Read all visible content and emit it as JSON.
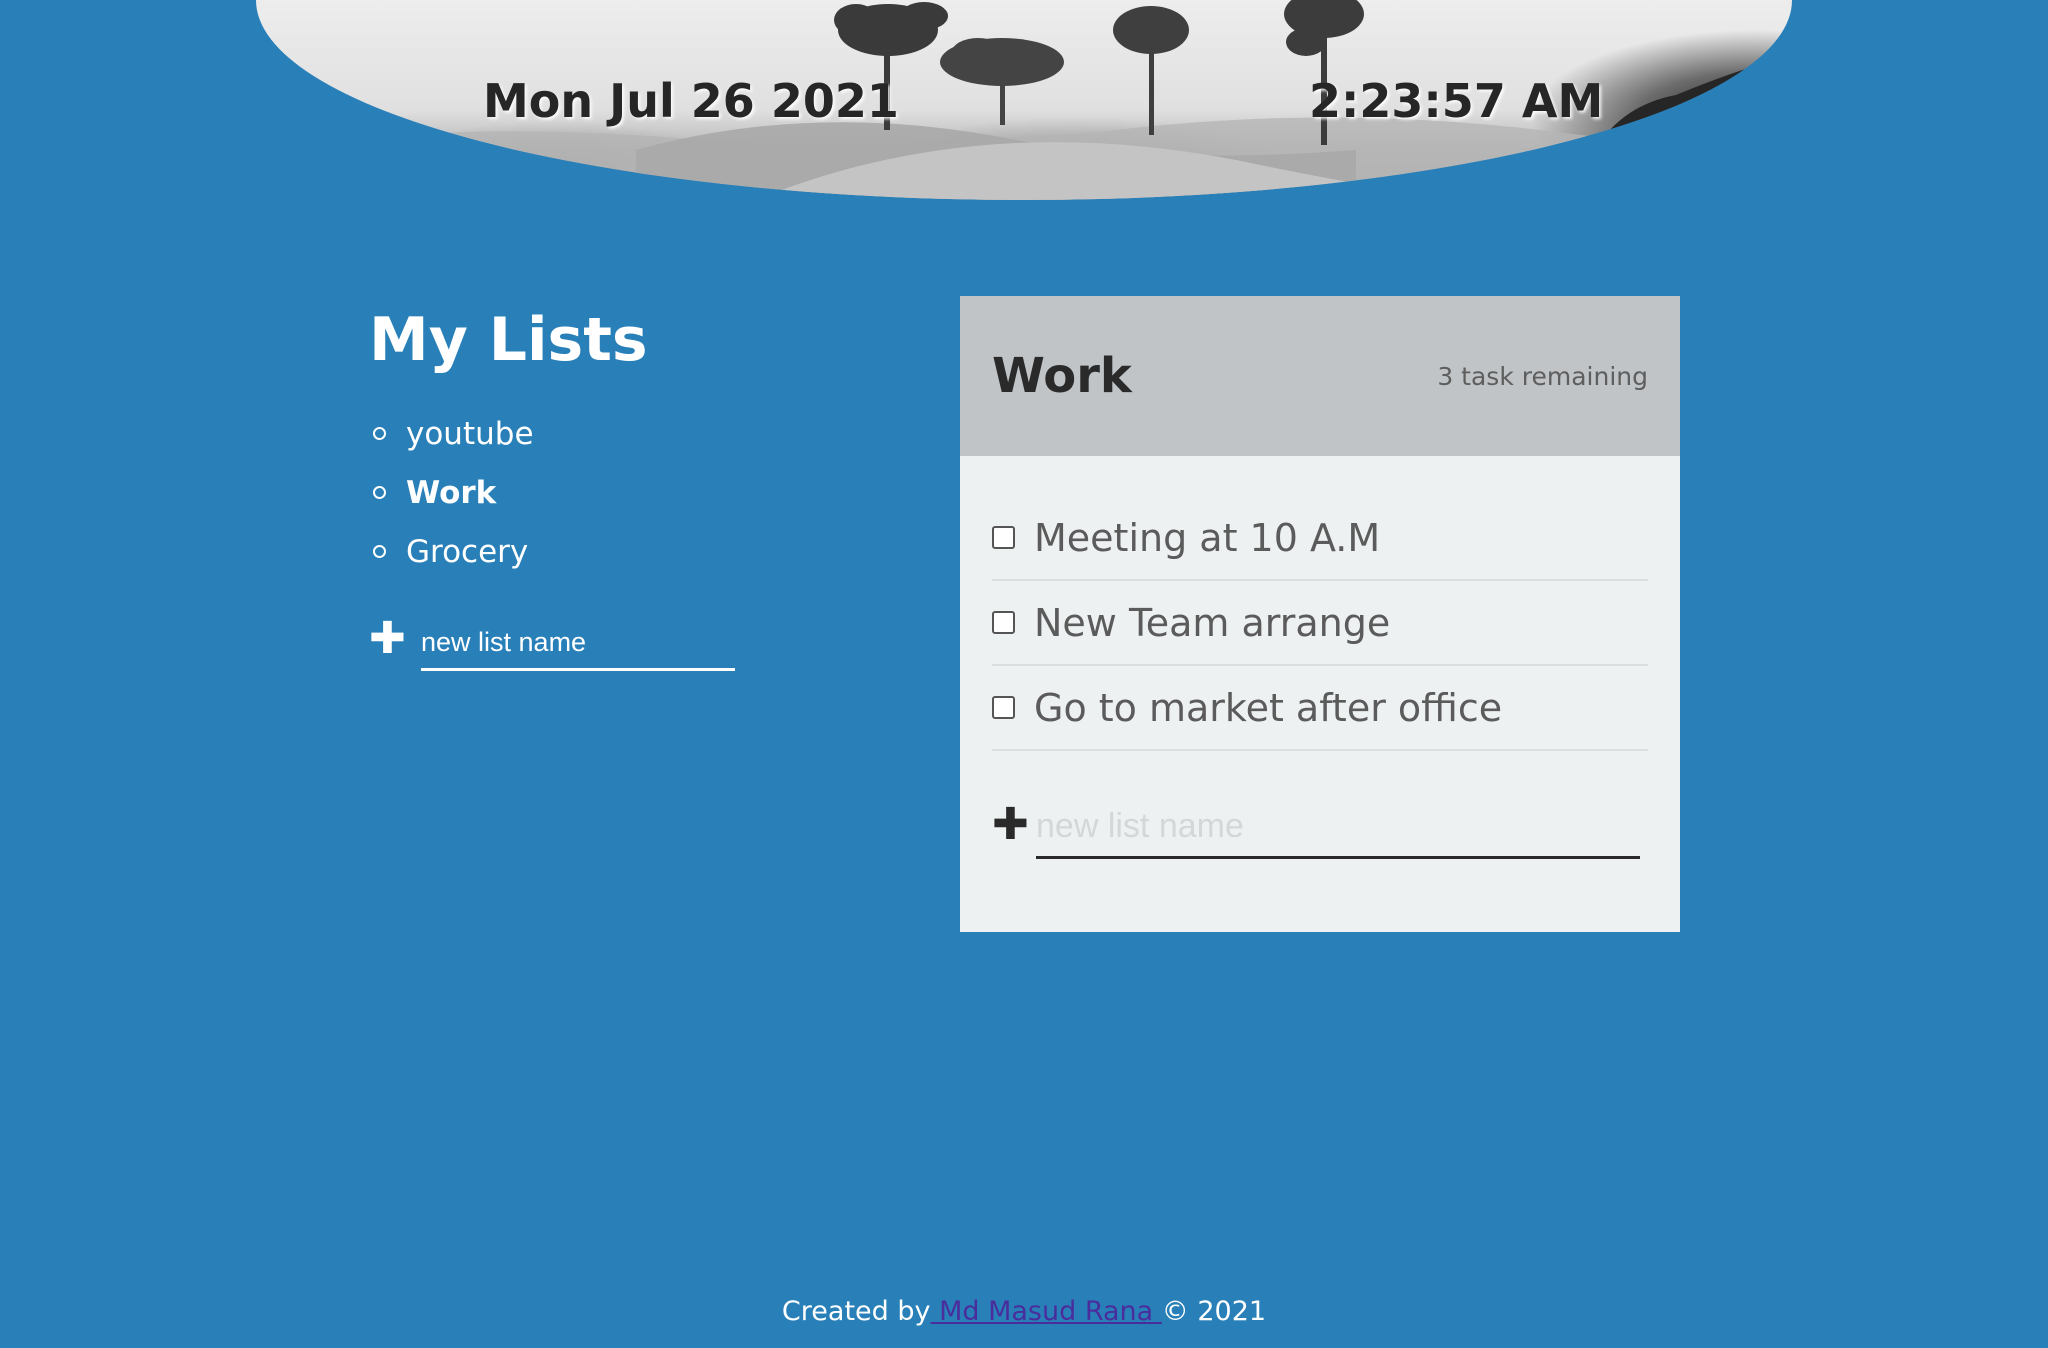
{
  "header": {
    "date": "Mon Jul 26 2021",
    "time": "2:23:57 AM"
  },
  "lists_panel": {
    "title": "My Lists",
    "items": [
      {
        "label": "youtube",
        "active": false
      },
      {
        "label": "Work",
        "active": true
      },
      {
        "label": "Grocery",
        "active": false
      }
    ],
    "new_list_placeholder": "new list name",
    "add_icon": "plus-icon"
  },
  "todo": {
    "title": "Work",
    "count_text": "3 task remaining",
    "tasks": [
      {
        "label": "Meeting at 10 A.M",
        "checked": false
      },
      {
        "label": "New Team arrange",
        "checked": false
      },
      {
        "label": "Go to market after office",
        "checked": false
      }
    ],
    "new_task_placeholder": "new list name",
    "add_icon": "plus-icon"
  },
  "footer": {
    "prefix": "Created by",
    "author": " Md Masud Rana ",
    "suffix": "© 2021"
  },
  "colors": {
    "background": "#2980b9",
    "card": "#eef1f2",
    "card_header": "#c0c4c7",
    "link": "#4a2d9c"
  }
}
